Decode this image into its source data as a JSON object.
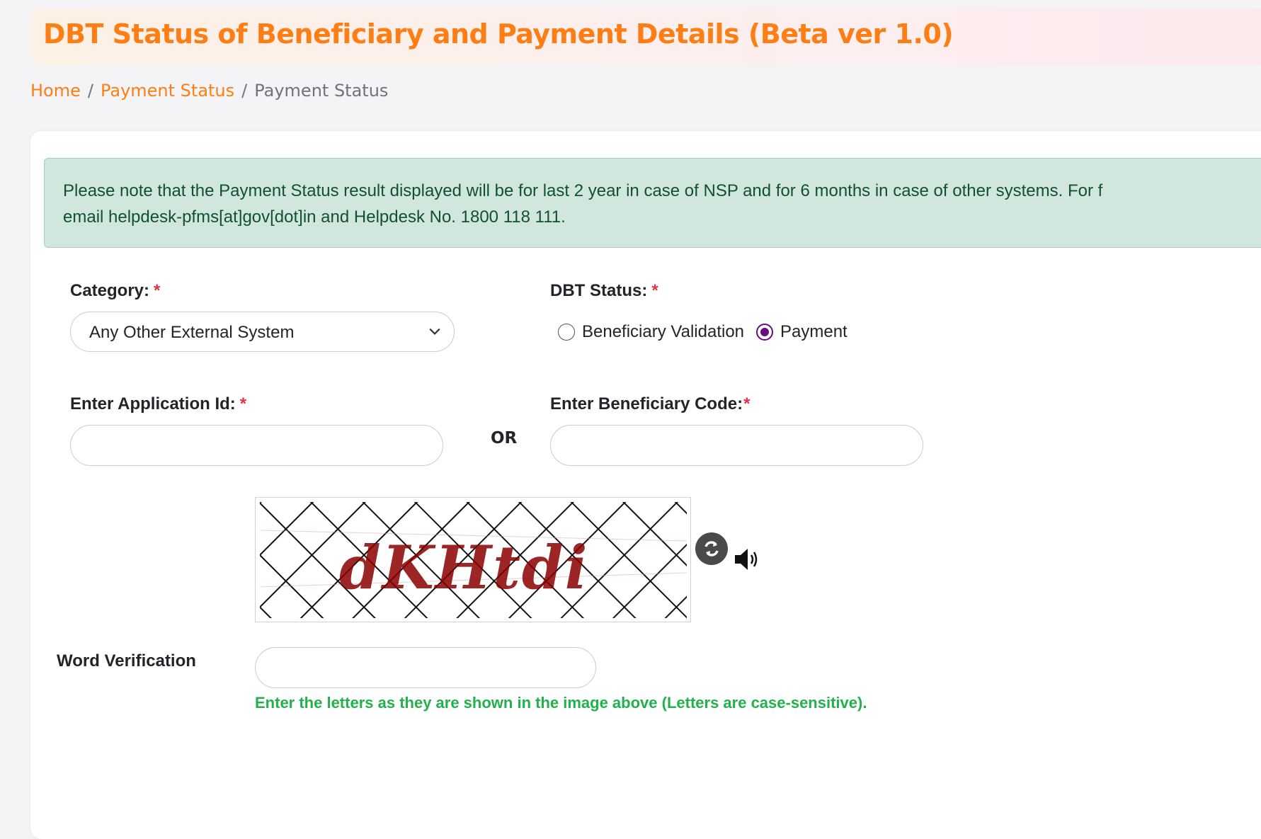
{
  "header": {
    "title": "DBT Status of Beneficiary and Payment Details (Beta ver 1.0)"
  },
  "breadcrumb": {
    "home": "Home",
    "section": "Payment Status",
    "current": "Payment Status",
    "separator": "/"
  },
  "notice": {
    "line1": "Please note that the Payment Status result displayed will be for last 2 year in case of NSP and for 6 months in case of other systems. For f",
    "line2": "email helpdesk-pfms[at]gov[dot]in and Helpdesk No. 1800 118 111."
  },
  "form": {
    "category": {
      "label": "Category:",
      "required_mark": "*",
      "selected": "Any Other External System"
    },
    "dbt_status": {
      "label": "DBT Status:",
      "required_mark": "*",
      "options": [
        {
          "label": "Beneficiary Validation",
          "checked": false
        },
        {
          "label": "Payment",
          "checked": true
        }
      ]
    },
    "application_id": {
      "label": "Enter Application Id:",
      "required_mark": "*",
      "value": ""
    },
    "or_label": "OR",
    "beneficiary_code": {
      "label": "Enter Beneficiary Code:",
      "required_mark": "*",
      "value": ""
    },
    "captcha": {
      "text": "dKHtdi",
      "refresh_icon": "refresh-icon",
      "audio_icon": "speaker-icon"
    },
    "word_verification": {
      "label": "Word Verification",
      "value": "",
      "hint": "Enter the letters as they are shown in the image above (Letters are case-sensitive)."
    }
  },
  "colors": {
    "brand_orange": "#fd7e14",
    "alert_bg": "#d1e7dd",
    "alert_text": "#0f5132",
    "required": "#dc3545",
    "radio_checked": "#6a0d83",
    "hint_green": "#22b14c"
  }
}
